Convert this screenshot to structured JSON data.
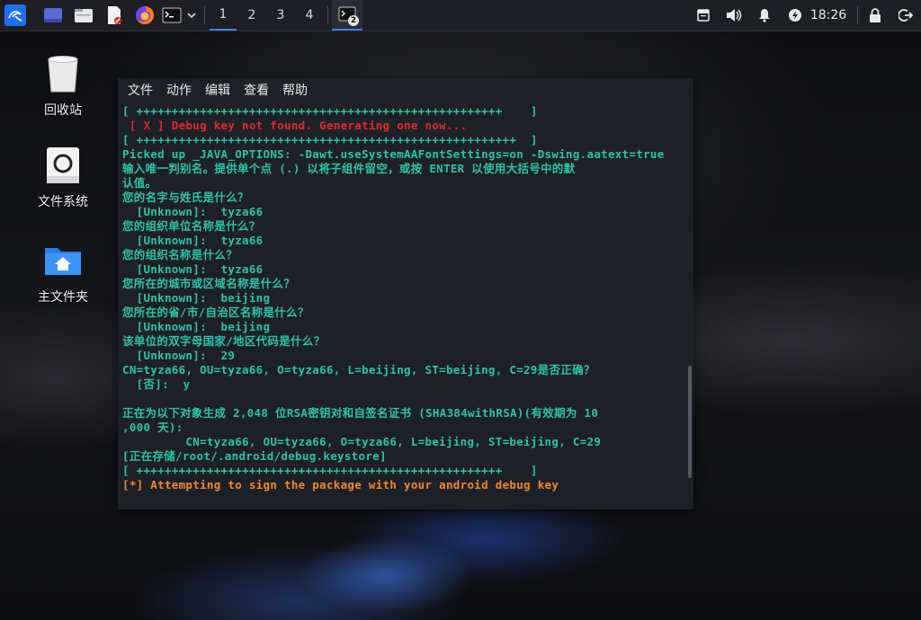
{
  "taskbar": {
    "workspaces": [
      "1",
      "2",
      "3",
      "4"
    ],
    "active_workspace": "1",
    "terminal_badge": "2",
    "clock": "18:26",
    "icons": [
      "kali-menu-icon",
      "desktop-icon",
      "file-manager-icon",
      "text-editor-icon",
      "firefox-icon",
      "terminal-icon",
      "chevron-down-icon",
      "terminal-window-icon",
      "notes-icon",
      "volume-icon",
      "bell-icon",
      "power-manager-icon",
      "lock-icon",
      "logout-icon"
    ]
  },
  "desktop": {
    "icons": [
      {
        "label": "回收站",
        "icon": "trash-icon"
      },
      {
        "label": "文件系统",
        "icon": "drive-icon"
      },
      {
        "label": "主文件夹",
        "icon": "home-folder-icon"
      }
    ]
  },
  "terminal": {
    "menu": [
      "文件",
      "动作",
      "编辑",
      "查看",
      "帮助"
    ],
    "lines": [
      {
        "text": "[ ++++++++++++++++++++++++++++++++++++++++++++++++++++    ]",
        "color": "teal"
      },
      {
        "text": " [ X ] Debug key not found. Generating one now...",
        "color": "red"
      },
      {
        "text": "[ ++++++++++++++++++++++++++++++++++++++++++++++++++++++  ]",
        "color": "teal"
      },
      {
        "text": "Picked up _JAVA_OPTIONS: -Dawt.useSystemAAFontSettings=on -Dswing.aatext=true",
        "color": "teal"
      },
      {
        "text": "输入唯一判别名。提供单个点 (.) 以将子组件留空，或按 ENTER 以使用大括号中的默",
        "color": "teal"
      },
      {
        "text": "认值。",
        "color": "teal"
      },
      {
        "text": "您的名字与姓氏是什么？",
        "color": "teal"
      },
      {
        "text": "  [Unknown]:  tyza66",
        "color": "teal"
      },
      {
        "text": "您的组织单位名称是什么？",
        "color": "teal"
      },
      {
        "text": "  [Unknown]:  tyza66",
        "color": "teal"
      },
      {
        "text": "您的组织名称是什么？",
        "color": "teal"
      },
      {
        "text": "  [Unknown]:  tyza66",
        "color": "teal"
      },
      {
        "text": "您所在的城市或区域名称是什么？",
        "color": "teal"
      },
      {
        "text": "  [Unknown]:  beijing",
        "color": "teal"
      },
      {
        "text": "您所在的省/市/自治区名称是什么？",
        "color": "teal"
      },
      {
        "text": "  [Unknown]:  beijing",
        "color": "teal"
      },
      {
        "text": "该单位的双字母国家/地区代码是什么？",
        "color": "teal"
      },
      {
        "text": "  [Unknown]:  29",
        "color": "teal"
      },
      {
        "text": "CN=tyza66, OU=tyza66, O=tyza66, L=beijing, ST=beijing, C=29是否正确？",
        "color": "teal"
      },
      {
        "text": "  [否]:  y",
        "color": "teal"
      },
      {
        "text": "",
        "color": "teal"
      },
      {
        "text": "正在为以下对象生成 2,048 位RSA密钥对和自签名证书 (SHA384withRSA)(有效期为 10",
        "color": "teal"
      },
      {
        "text": ",000 天):",
        "color": "teal"
      },
      {
        "text": "         CN=tyza66, OU=tyza66, O=tyza66, L=beijing, ST=beijing, C=29",
        "color": "teal"
      },
      {
        "text": "[正在存储/root/.android/debug.keystore]",
        "color": "teal"
      },
      {
        "text": "[ ++++++++++++++++++++++++++++++++++++++++++++++++++++    ]",
        "color": "teal"
      },
      {
        "text": "[*] Attempting to sign the package with your android debug key",
        "color": "orange"
      }
    ]
  },
  "colors": {
    "teal": "#2fc2a9",
    "red": "#e22a2a",
    "orange": "#f0882d",
    "accent": "#3b82f6"
  }
}
